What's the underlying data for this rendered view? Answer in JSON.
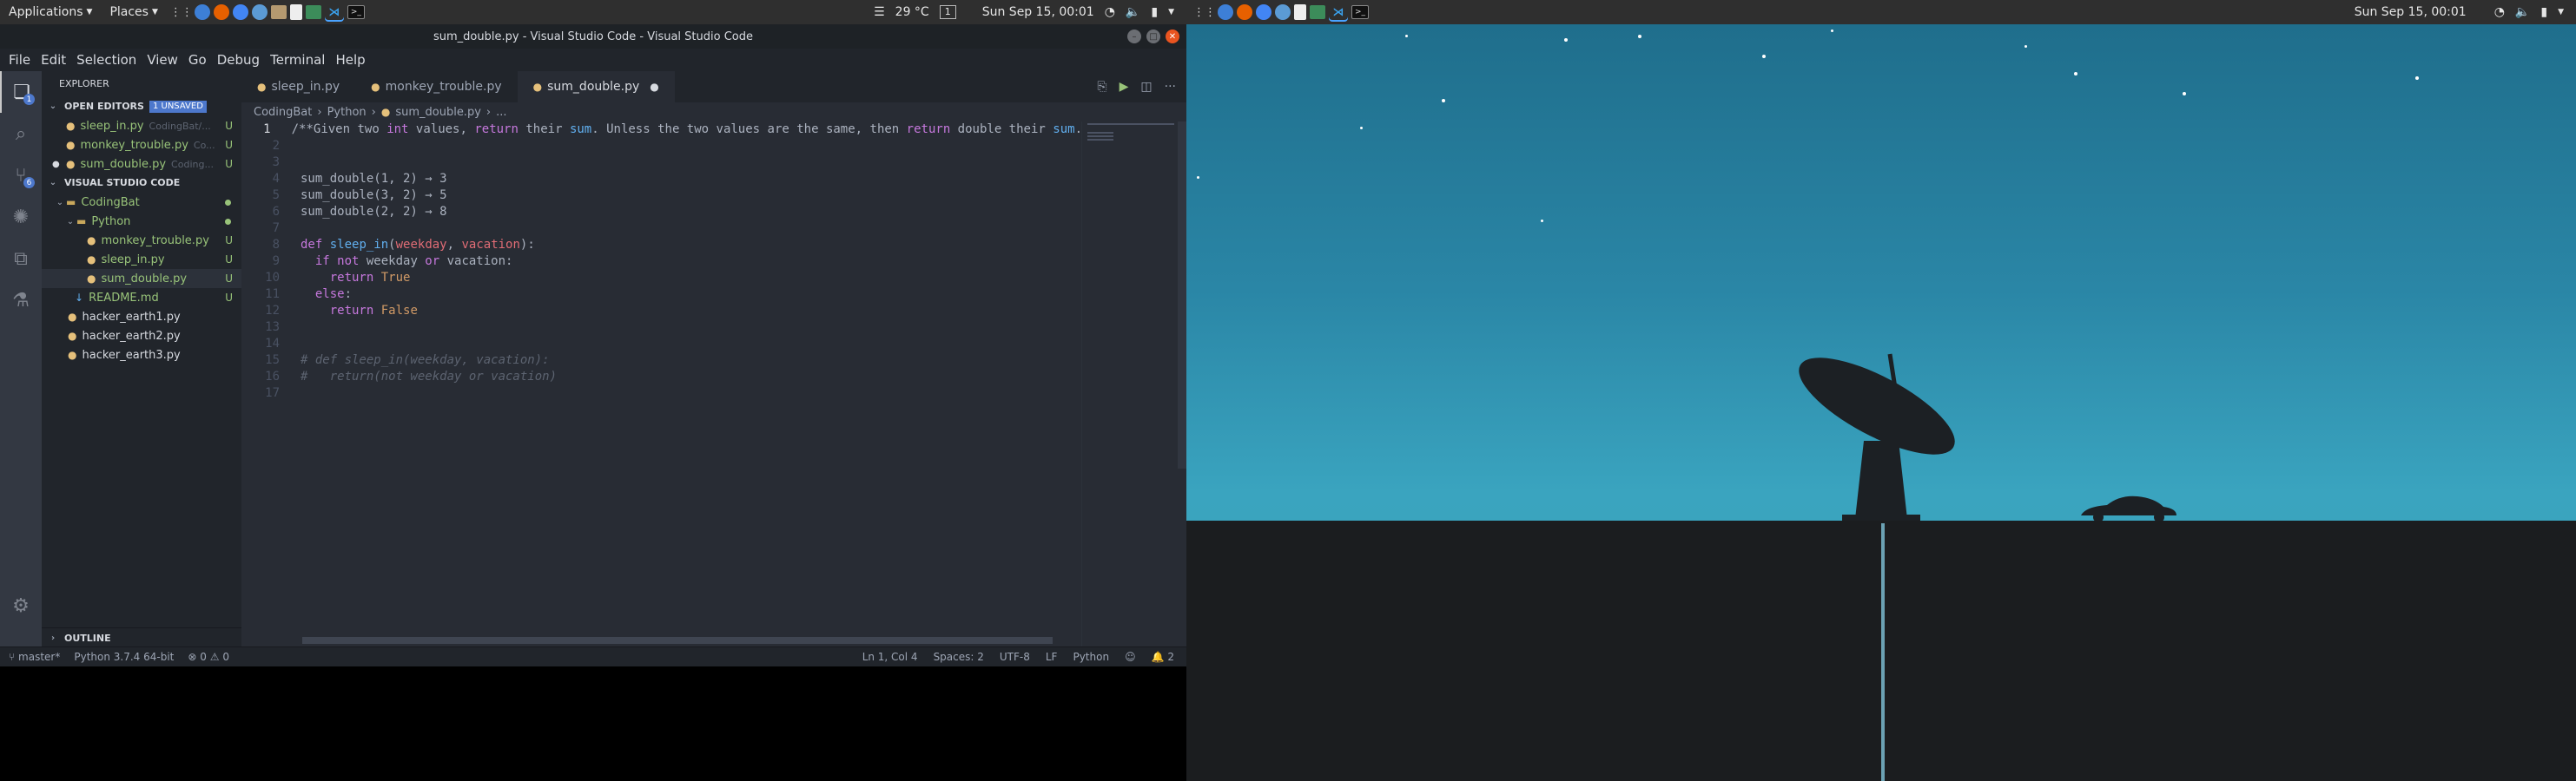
{
  "top_panel_left": {
    "applications": "Applications",
    "places": "Places",
    "temperature": "29 °C",
    "workspace": "1",
    "clock": "Sun Sep 15, 00:01"
  },
  "top_panel_right": {
    "clock": "Sun Sep 15, 00:01"
  },
  "window": {
    "title": "sum_double.py - Visual Studio Code - Visual Studio Code"
  },
  "menu": [
    "File",
    "Edit",
    "Selection",
    "View",
    "Go",
    "Debug",
    "Terminal",
    "Help"
  ],
  "explorer": {
    "header": "EXPLORER",
    "open_editors_label": "OPEN EDITORS",
    "unsaved_badge": "1 UNSAVED",
    "open_editors": [
      {
        "name": "sleep_in.py",
        "path": "CodingBat/...",
        "status": "U"
      },
      {
        "name": "monkey_trouble.py",
        "path": "Co...",
        "status": "U"
      },
      {
        "name": "sum_double.py",
        "path": "Coding...",
        "status": "U"
      }
    ],
    "workspace_label": "VISUAL STUDIO CODE",
    "tree": [
      {
        "name": "CodingBat"
      },
      {
        "name": "Python"
      },
      {
        "name": "monkey_trouble.py",
        "status": "U"
      },
      {
        "name": "sleep_in.py",
        "status": "U"
      },
      {
        "name": "sum_double.py",
        "status": "U"
      },
      {
        "name": "README.md",
        "status": "U"
      },
      {
        "name": "hacker_earth1.py"
      },
      {
        "name": "hacker_earth2.py"
      },
      {
        "name": "hacker_earth3.py"
      }
    ],
    "outline_label": "OUTLINE"
  },
  "tabs": [
    "sleep_in.py",
    "monkey_trouble.py",
    "sum_double.py"
  ],
  "breadcrumbs": [
    "CodingBat",
    "Python",
    "sum_double.py",
    "..."
  ],
  "code_lines": {
    "l1": "/**Given two int values, return their sum. Unless the two values are the same, then return double their sum.",
    "l4": "sum_double(1, 2) → 3",
    "l5": "sum_double(3, 2) → 5",
    "l6": "sum_double(2, 2) → 8",
    "l15": "# def sleep_in(weekday, vacation):",
    "l16": "#   return(not weekday or vacation)"
  },
  "status_bar": {
    "branch": "master*",
    "python": "Python 3.7.4 64-bit",
    "problems": "0",
    "warnings": "0",
    "position": "Ln 1, Col 4",
    "spaces": "Spaces: 2",
    "encoding": "UTF-8",
    "eol": "LF",
    "language": "Python",
    "notifications": "2"
  },
  "colors": {
    "accent": "#4d78cc",
    "git_untracked": "#98c379",
    "keyword": "#c678dd",
    "function": "#61afef",
    "param": "#e06c75",
    "number": "#d19a66"
  }
}
